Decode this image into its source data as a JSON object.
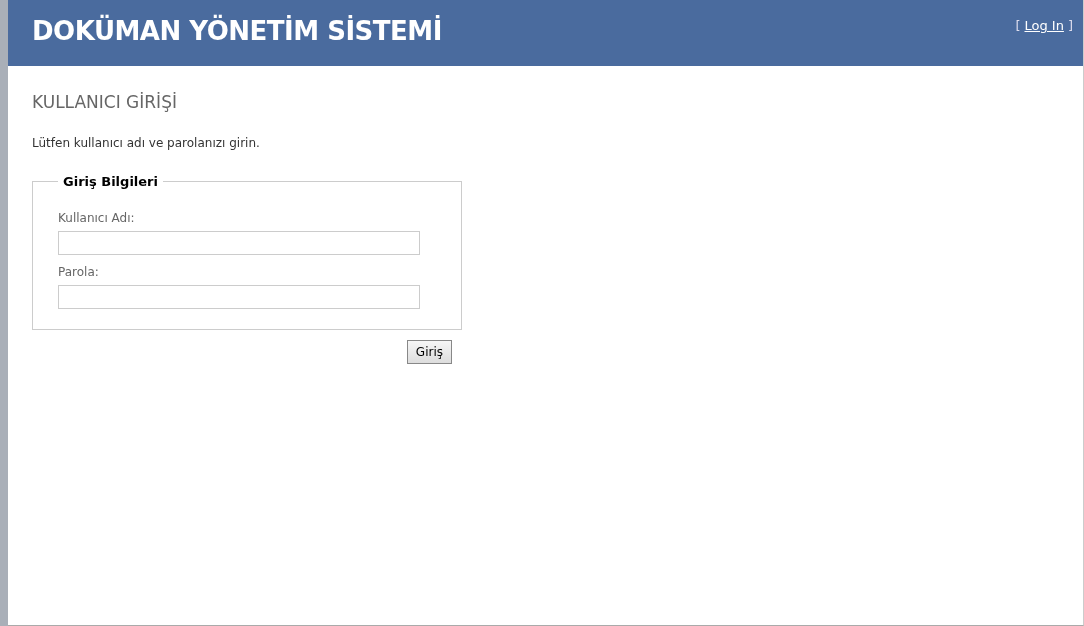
{
  "header": {
    "title": "DOKÜMAN YÖNETİM SİSTEMİ",
    "login": {
      "open": "[",
      "link": "Log In",
      "close": "]"
    }
  },
  "main": {
    "heading": "KULLANICI GİRİŞİ",
    "instruction": "Lütfen kullanıcı adı ve parolanızı girin.",
    "fieldset": {
      "legend": "Giriş Bilgileri",
      "fields": [
        {
          "label": "Kullanıcı Adı:"
        },
        {
          "label": "Parola:"
        }
      ]
    },
    "submit": "Giriş"
  }
}
